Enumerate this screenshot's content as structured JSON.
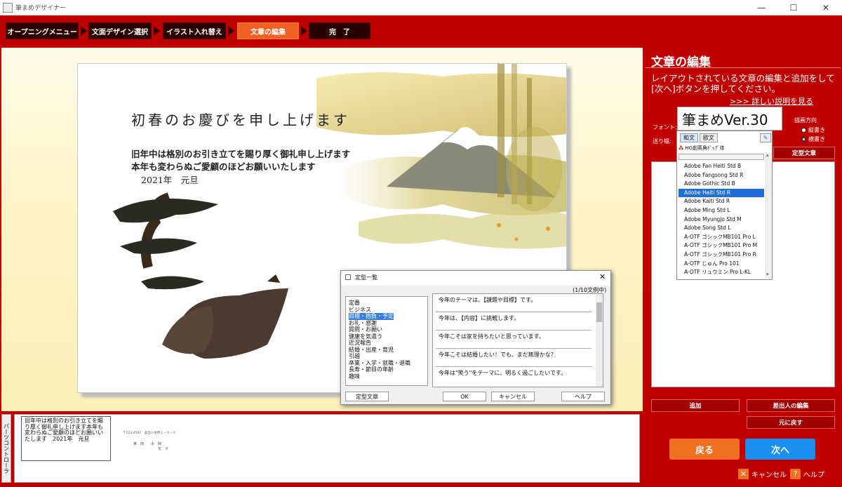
{
  "window": {
    "title": "筆まめデザイナー",
    "minimize": "—",
    "maximize": "☐",
    "close": "✕"
  },
  "steps": [
    {
      "label": "オープニングメニュー",
      "active": false
    },
    {
      "label": "文面デザイン選択",
      "active": false
    },
    {
      "label": "イラスト入れ替え",
      "active": false
    },
    {
      "label": "文章の編集",
      "active": true
    },
    {
      "label": "完　了",
      "active": false
    }
  ],
  "card": {
    "title": "初春のお慶びを申し上げます",
    "line1": "旧年中は格別のお引き立てを賜り厚く御礼申し上げます",
    "line2": "本年も変わらぬご愛顧のほどお願いいたします",
    "line3": "2021年　元旦"
  },
  "dialog": {
    "title": "定型一覧",
    "counter": "(1/10文例中)",
    "categories": [
      "定番",
      "ビジネス",
      "目標・抱負・予定",
      "お礼・感謝",
      "質問・お願い",
      "健康を気遣う",
      "近況報告",
      "結婚・出産・育児",
      "引越",
      "卒業・入学・就職・退職",
      "長寿・節目の年齢",
      "趣味"
    ],
    "selected_category": "目標・抱負・予定",
    "templates": [
      "今年のテーマは、【課題や目標】です。",
      "今年は、【内容】に挑戦します。",
      "今年こそは家を持ちたいと思っています。",
      "今年こそは結婚したい！でも、まだ無理かな？",
      "今年は\"笑う\"をテーマに、明るく過ごしたいです。"
    ],
    "buttons": {
      "teikei": "定型文章",
      "ok": "OK",
      "cancel": "キャンセル",
      "help": "ヘルプ"
    }
  },
  "parts": {
    "tab_label": "パーツコントローラ",
    "preview_text": "旧年中は格別のお引き立てを賜り厚く御礼申し上げます本年も変わらぬご愛顧のほどお願いいたします　2021年　元旦",
    "sender_line": "〒123-4567　差出人住所１－０－０",
    "sender_name1": "筆　田　　太　郎",
    "sender_name2": "　　　　　　　花　子"
  },
  "right_panel": {
    "title": "文章の編集",
    "description": "レイアウトされている文章の編集と追加をして[次へ]ボタンを押してください。",
    "link": ">>> 詳しい説明を見る",
    "font_label": "フォント:",
    "spacing_label": "送り幅:",
    "direction_label": "描画方向",
    "vertical": "縦書き",
    "horizontal": "横書き",
    "teikei_button": "定型文章",
    "add_button": "追加",
    "sender_edit_button": "差出人の編集",
    "undo_button": "元に戻す",
    "back_button": "戻る",
    "next_button": "次へ",
    "cancel": "キャンセル",
    "help": "ヘルプ"
  },
  "font_dropdown": {
    "current": "筆まめVer.30",
    "tab_jp": "和文",
    "tab_en": "欧文",
    "top_item": "HG創英角ﾎﾟｯﾌﾟ体",
    "items": [
      "Adobe Fan Heiti Std B",
      "Adobe Fangsong Std R",
      "Adobe Gothic Std B",
      "Adobe Heiti Std R",
      "Adobe Kaiti Std R",
      "Adobe Ming Std L",
      "Adobe Myungjo Std M",
      "Adobe Song Std L",
      "A-OTF ゴシックMB101 Pro L",
      "A-OTF ゴシックMB101 Pro M",
      "A-OTF ゴシックMB101 Pro R",
      "A-OTF じゅん Pro 101",
      "A-OTF リュウミン Pro L-KL"
    ],
    "selected": "Adobe Heiti Std R"
  },
  "colors": {
    "brand_red": "#c00000",
    "active_step": "#f06020",
    "back": "#f07020",
    "next": "#1a8ff0"
  }
}
